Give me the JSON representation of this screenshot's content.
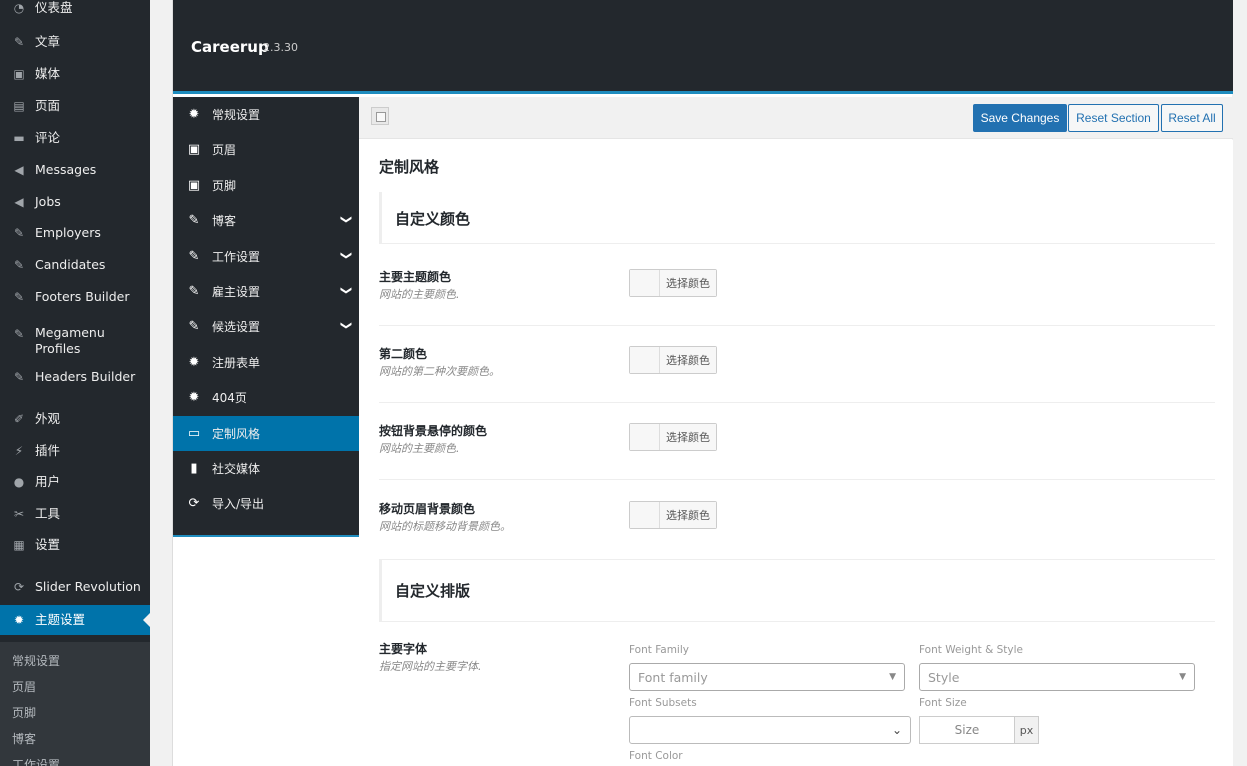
{
  "wp_menu": {
    "items": [
      {
        "label": "仪表盘",
        "icon": "dashboard-icon",
        "glyph": "◔"
      },
      {
        "label": "文章",
        "icon": "pin-icon",
        "glyph": "✎"
      },
      {
        "label": "媒体",
        "icon": "media-icon",
        "glyph": "▣"
      },
      {
        "label": "页面",
        "icon": "page-icon",
        "glyph": "▤"
      },
      {
        "label": "评论",
        "icon": "comment-icon",
        "glyph": "▬"
      },
      {
        "label": "Messages",
        "icon": "megaphone-icon",
        "glyph": "◀"
      },
      {
        "label": "Jobs",
        "icon": "megaphone-icon",
        "glyph": "◀"
      },
      {
        "label": "Employers",
        "icon": "pin-icon",
        "glyph": "✎"
      },
      {
        "label": "Candidates",
        "icon": "pin-icon",
        "glyph": "✎"
      },
      {
        "label": "Footers Builder",
        "icon": "pin-icon",
        "glyph": "✎"
      },
      {
        "label": "Megamenu Profiles",
        "icon": "pin-icon",
        "glyph": "✎"
      },
      {
        "label": "Headers Builder",
        "icon": "pin-icon",
        "glyph": "✎"
      },
      {
        "label": "外观",
        "icon": "brush-icon",
        "glyph": "✐"
      },
      {
        "label": "插件",
        "icon": "plugin-icon",
        "glyph": "⚡"
      },
      {
        "label": "用户",
        "icon": "user-icon",
        "glyph": "●"
      },
      {
        "label": "工具",
        "icon": "wrench-icon",
        "glyph": "✂"
      },
      {
        "label": "设置",
        "icon": "settings-icon",
        "glyph": "▦"
      },
      {
        "label": "Slider Revolution",
        "icon": "refresh-icon",
        "glyph": "⟳"
      },
      {
        "label": "主题设置",
        "icon": "gear-icon",
        "glyph": "✹"
      }
    ],
    "submenu": [
      "常规设置",
      "页眉",
      "页脚",
      "博客",
      "工作设置"
    ]
  },
  "panel": {
    "theme_name": "Careerup",
    "theme_version": "2.3.30",
    "nav": [
      {
        "label": "常规设置",
        "icon": "gears-icon",
        "glyph": "✹"
      },
      {
        "label": "页眉",
        "icon": "window-icon",
        "glyph": "▣"
      },
      {
        "label": "页脚",
        "icon": "window-icon",
        "glyph": "▣"
      },
      {
        "label": "博客",
        "icon": "pencil-icon",
        "glyph": "✎",
        "chevron": "❯"
      },
      {
        "label": "工作设置",
        "icon": "pencil-icon",
        "glyph": "✎",
        "chevron": "❯"
      },
      {
        "label": "雇主设置",
        "icon": "pencil-icon",
        "glyph": "✎",
        "chevron": "❯"
      },
      {
        "label": "候选设置",
        "icon": "pencil-icon",
        "glyph": "✎",
        "chevron": "❯"
      },
      {
        "label": "注册表单",
        "icon": "gear-icon",
        "glyph": "✹"
      },
      {
        "label": "404页",
        "icon": "gear-icon",
        "glyph": "✹"
      },
      {
        "label": "定制风格",
        "icon": "css-icon",
        "glyph": "▭"
      },
      {
        "label": "社交媒体",
        "icon": "phone-icon",
        "glyph": "▮"
      },
      {
        "label": "导入/导出",
        "icon": "refresh-icon",
        "glyph": "⟳"
      }
    ],
    "active_nav": "定制风格"
  },
  "toolbar": {
    "save_label": "Save Changes",
    "reset_section_label": "Reset Section",
    "reset_all_label": "Reset All"
  },
  "content": {
    "section_title": "定制风格",
    "color_section": "自定义颜色",
    "color_fields": [
      {
        "title": "主要主题颜色",
        "desc": "网站的主要颜色.",
        "button": "选择颜色"
      },
      {
        "title": "第二颜色",
        "desc": "网站的第二种次要颜色。",
        "button": "选择颜色"
      },
      {
        "title": "按钮背景悬停的颜色",
        "desc": "网站的主要颜色.",
        "button": "选择颜色"
      },
      {
        "title": "移动页眉背景颜色",
        "desc": "网站的标题移动背景颜色。",
        "button": "选择颜色"
      }
    ],
    "typography_section": "自定义排版",
    "font_field": {
      "title": "主要字体",
      "desc": "指定网站的主要字体.",
      "font_family_label": "Font Family",
      "font_family_placeholder": "Font family",
      "font_weight_label": "Font Weight & Style",
      "font_weight_placeholder": "Style",
      "font_subsets_label": "Font Subsets",
      "font_subsets_value": "",
      "font_size_label": "Font Size",
      "font_size_placeholder": "Size",
      "font_size_unit": "px",
      "font_color_label": "Font Color"
    }
  }
}
